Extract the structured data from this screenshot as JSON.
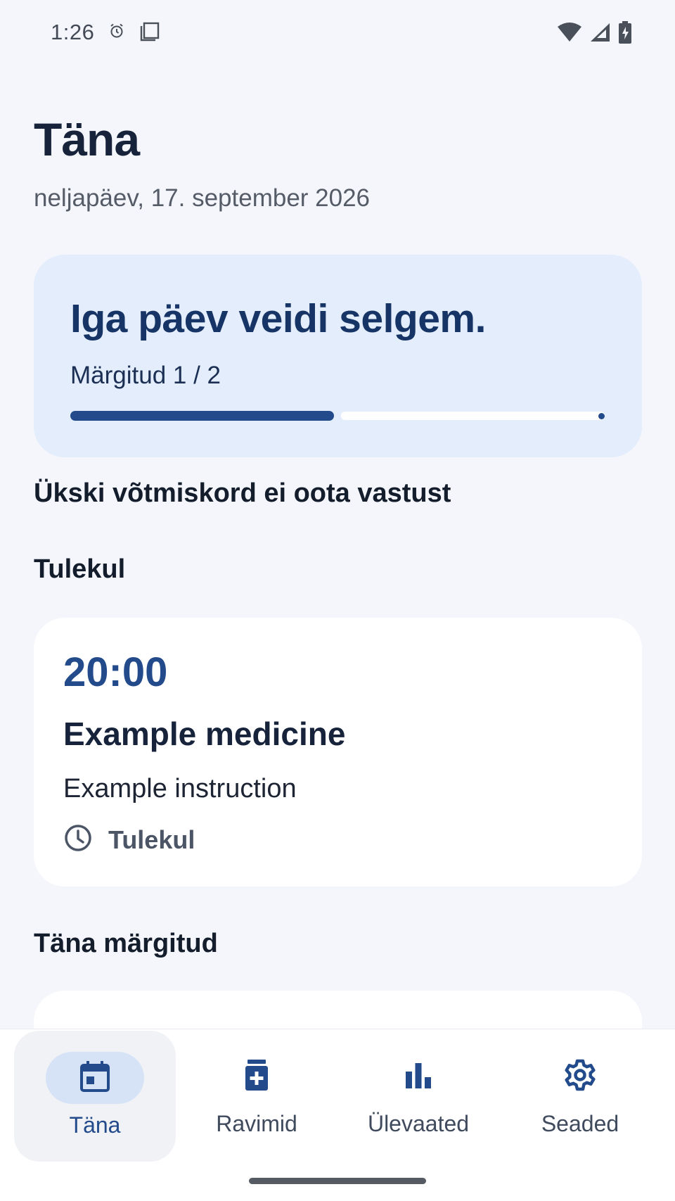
{
  "status_bar": {
    "time": "1:26",
    "icons": [
      "alarm-icon",
      "screen-icon",
      "wifi-icon",
      "signal-icon",
      "battery-charging-icon"
    ]
  },
  "header": {
    "title": "Täna",
    "date": "neljapäev, 17. september 2026"
  },
  "progress_card": {
    "headline": "Iga päev veidi selgem.",
    "label": "Märgitud 1 / 2",
    "done": 1,
    "total": 2,
    "accent_color": "#234b8c",
    "background_color": "#e3edfb"
  },
  "pending_heading": "Ükski võtmiskord ei oota vastust",
  "upcoming": {
    "heading": "Tulekul",
    "dose": {
      "time": "20:00",
      "name": "Example medicine",
      "instruction": "Example instruction",
      "status": "Tulekul",
      "status_icon": "clock-icon"
    }
  },
  "done_today": {
    "heading": "Täna märgitud"
  },
  "bottom_nav": {
    "items": [
      {
        "label": "Täna",
        "icon": "calendar-icon",
        "active": true
      },
      {
        "label": "Ravimid",
        "icon": "medicine-bottle-icon",
        "active": false
      },
      {
        "label": "Ülevaated",
        "icon": "bar-chart-icon",
        "active": false
      },
      {
        "label": "Seaded",
        "icon": "gear-icon",
        "active": false
      }
    ]
  }
}
